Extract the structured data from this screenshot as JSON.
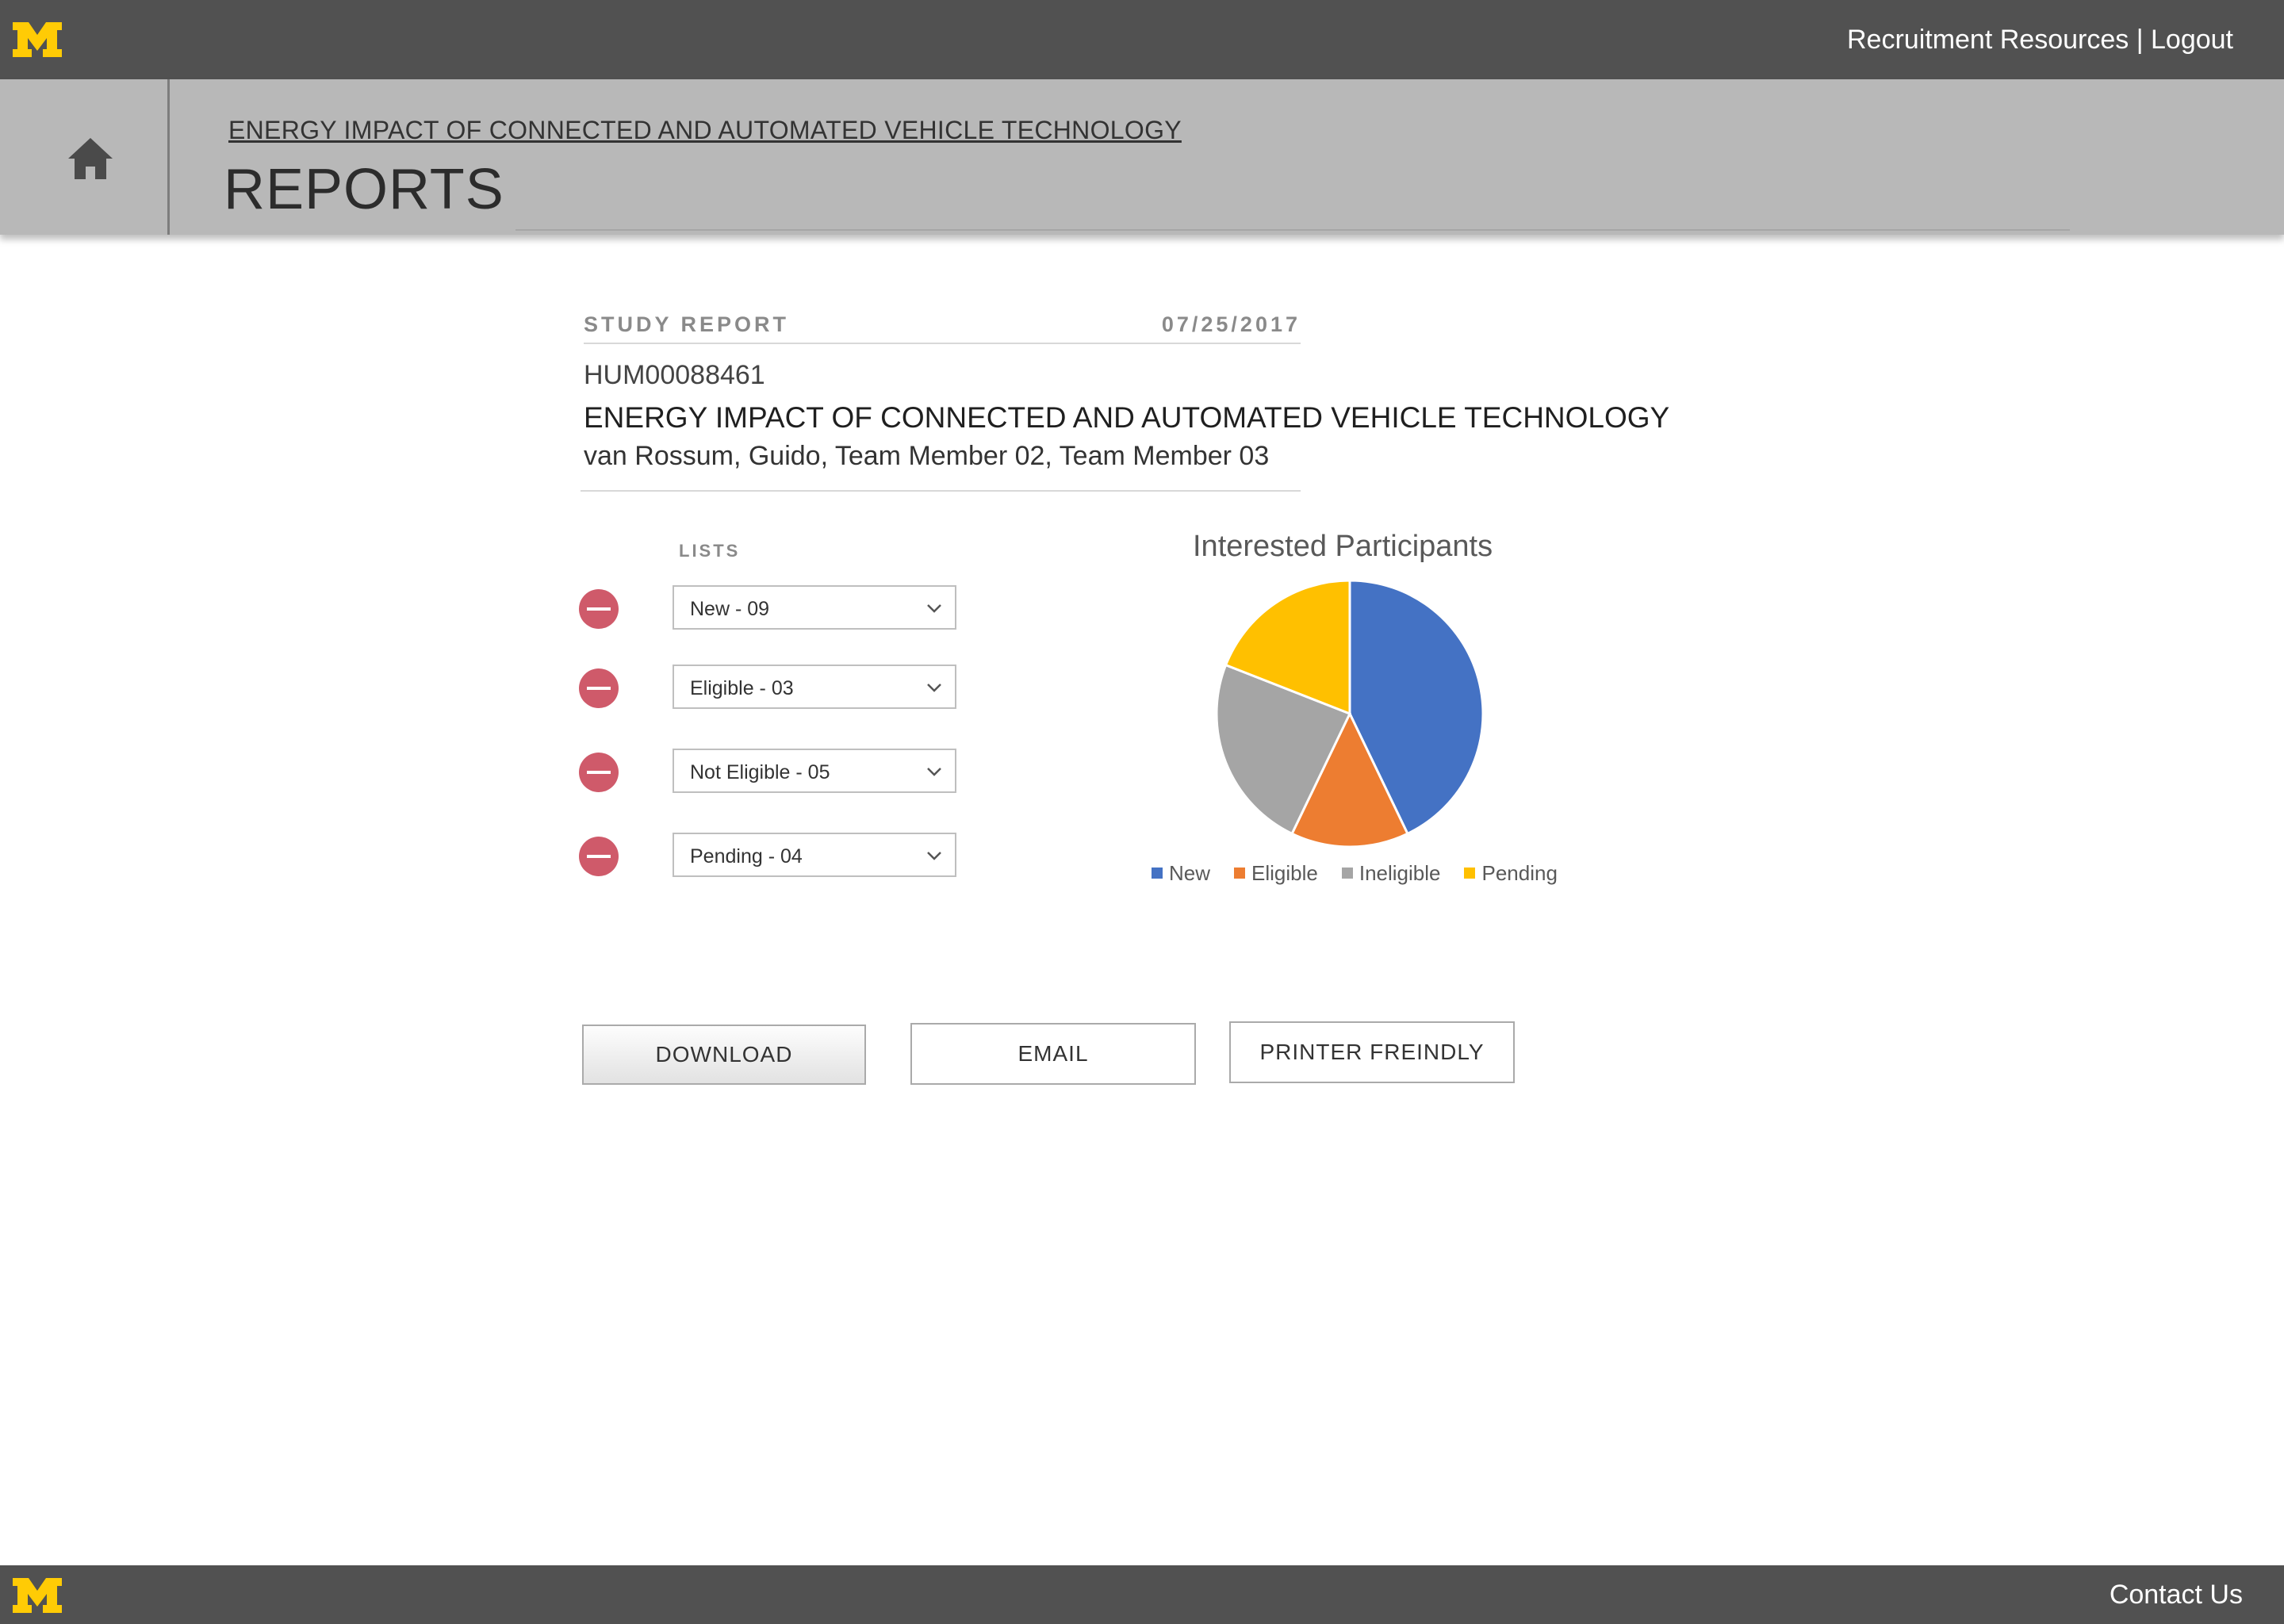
{
  "topbar": {
    "logo_alt": "M",
    "link_resources": "Recruitment Resources",
    "separator": "|",
    "link_logout": "Logout"
  },
  "header": {
    "breadcrumb": "ENERGY IMPACT OF CONNECTED AND AUTOMATED VEHICLE TECHNOLOGY",
    "title": "REPORTS"
  },
  "report": {
    "label": "STUDY REPORT",
    "date": "07/25/2017",
    "id": "HUM00088461",
    "title": "ENERGY IMPACT OF CONNECTED AND AUTOMATED VEHICLE TECHNOLOGY",
    "team": "van Rossum, Guido, Team Member 02, Team Member 03"
  },
  "lists": {
    "label": "LISTS",
    "items": [
      {
        "value": "New - 09"
      },
      {
        "value": "Eligible - 03"
      },
      {
        "value": "Not Eligible - 05"
      },
      {
        "value": "Pending - 04"
      }
    ]
  },
  "chart_data": {
    "type": "pie",
    "title": "Interested Participants",
    "categories": [
      "New",
      "Eligible",
      "Ineligible",
      "Pending"
    ],
    "values": [
      9,
      3,
      5,
      4
    ],
    "colors": [
      "#4472c4",
      "#ed7d31",
      "#a5a5a5",
      "#ffc000"
    ],
    "legend_position": "bottom"
  },
  "buttons": {
    "download": "DOWNLOAD",
    "email": "EMAIL",
    "print": "PRINTER FREINDLY"
  },
  "footer": {
    "contact": "Contact Us"
  },
  "colors": {
    "bar": "#515151",
    "header": "#b8b8b8",
    "logo": "#ffcb05",
    "remove": "#cf5a6a"
  },
  "icons": {
    "logo": "block-m-logo",
    "home": "home-icon",
    "remove": "remove-circle-icon",
    "dropdown": "chevron-down-icon"
  }
}
